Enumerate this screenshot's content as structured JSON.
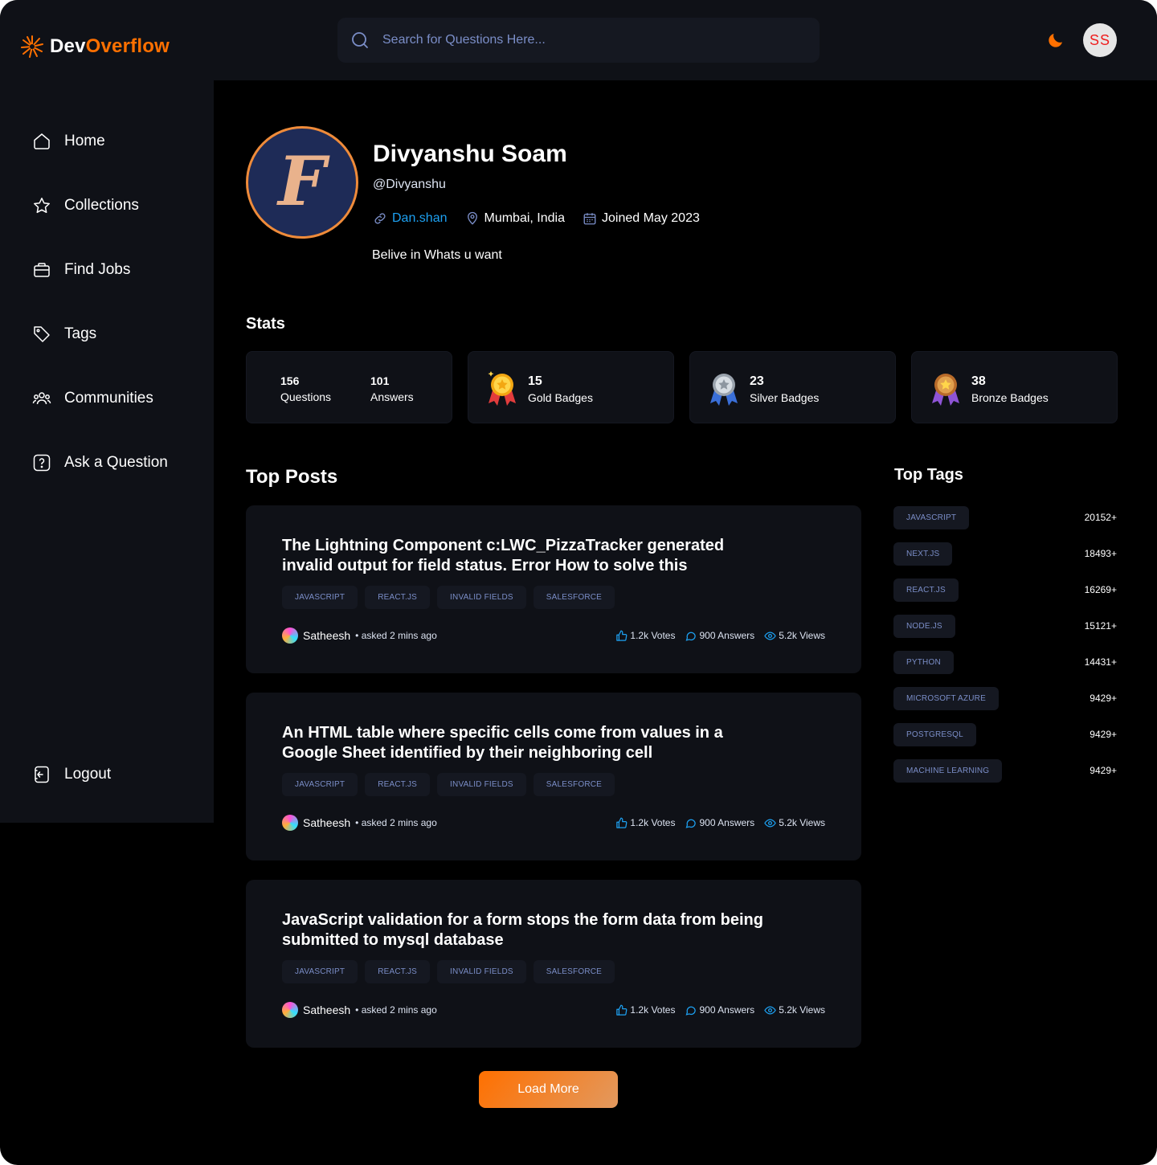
{
  "header": {
    "logo_part1": "Dev",
    "logo_part2": "Overflow",
    "search_placeholder": "Search for Questions Here...",
    "user_initials": "SS"
  },
  "sidebar": {
    "items": [
      {
        "label": "Home",
        "icon": "home-icon"
      },
      {
        "label": "Collections",
        "icon": "star-icon"
      },
      {
        "label": "Find Jobs",
        "icon": "briefcase-icon"
      },
      {
        "label": "Tags",
        "icon": "tag-icon"
      },
      {
        "label": "Communities",
        "icon": "users-icon"
      },
      {
        "label": "Ask a Question",
        "icon": "question-icon"
      }
    ],
    "logout_label": "Logout"
  },
  "profile": {
    "avatar_letter": "F",
    "name": "Divyanshu Soam",
    "username": "@Divyanshu",
    "portfolio": "Dan.shan",
    "location": "Mumbai, India",
    "joined": "Joined May 2023",
    "bio": "Belive in Whats u want"
  },
  "stats": {
    "title": "Stats",
    "questions": {
      "value": "156",
      "label": "Questions"
    },
    "answers": {
      "value": "101",
      "label": "Answers"
    },
    "badges": [
      {
        "value": "15",
        "label": "Gold Badges",
        "icon": "gold-medal-icon"
      },
      {
        "value": "23",
        "label": "Silver Badges",
        "icon": "silver-medal-icon"
      },
      {
        "value": "38",
        "label": "Bronze Badges",
        "icon": "bronze-medal-icon"
      }
    ]
  },
  "top_posts": {
    "title": "Top Posts",
    "posts": [
      {
        "title": "The Lightning Component c:LWC_PizzaTracker generated invalid output for field status. Error How to solve this",
        "tags": [
          "JAVASCRIPT",
          "REACT.JS",
          "INVALID FIELDS",
          "SALESFORCE"
        ],
        "author": "Satheesh",
        "asked": "• asked 2 mins ago",
        "votes": "1.2k Votes",
        "answers": "900 Answers",
        "views": "5.2k Views"
      },
      {
        "title": "An HTML table where specific cells come from values in a Google Sheet identified by their neighboring cell",
        "tags": [
          "JAVASCRIPT",
          "REACT.JS",
          "INVALID FIELDS",
          "SALESFORCE"
        ],
        "author": "Satheesh",
        "asked": "• asked 2 mins ago",
        "votes": "1.2k Votes",
        "answers": "900 Answers",
        "views": "5.2k Views"
      },
      {
        "title": "JavaScript validation for a form stops the form data from being submitted to mysql database",
        "tags": [
          "JAVASCRIPT",
          "REACT.JS",
          "INVALID FIELDS",
          "SALESFORCE"
        ],
        "author": "Satheesh",
        "asked": "• asked 2 mins ago",
        "votes": "1.2k Votes",
        "answers": "900 Answers",
        "views": "5.2k Views"
      }
    ],
    "load_more": "Load More"
  },
  "top_tags": {
    "title": "Top Tags",
    "tags": [
      {
        "name": "JAVASCRIPT",
        "count": "20152+"
      },
      {
        "name": "NEXT.JS",
        "count": "18493+"
      },
      {
        "name": "REACT.JS",
        "count": "16269+"
      },
      {
        "name": "NODE.JS",
        "count": "15121+"
      },
      {
        "name": "PYTHON",
        "count": "14431+"
      },
      {
        "name": "MICROSOFT AZURE",
        "count": "9429+"
      },
      {
        "name": "POSTGRESQL",
        "count": "9429+"
      },
      {
        "name": "MACHINE LEARNING",
        "count": "9429+"
      }
    ]
  },
  "colors": {
    "accent": "#ff7000",
    "link": "#1da1f2",
    "tag_text": "#7b8ec8",
    "panel": "#0f1117",
    "background": "#000000"
  }
}
